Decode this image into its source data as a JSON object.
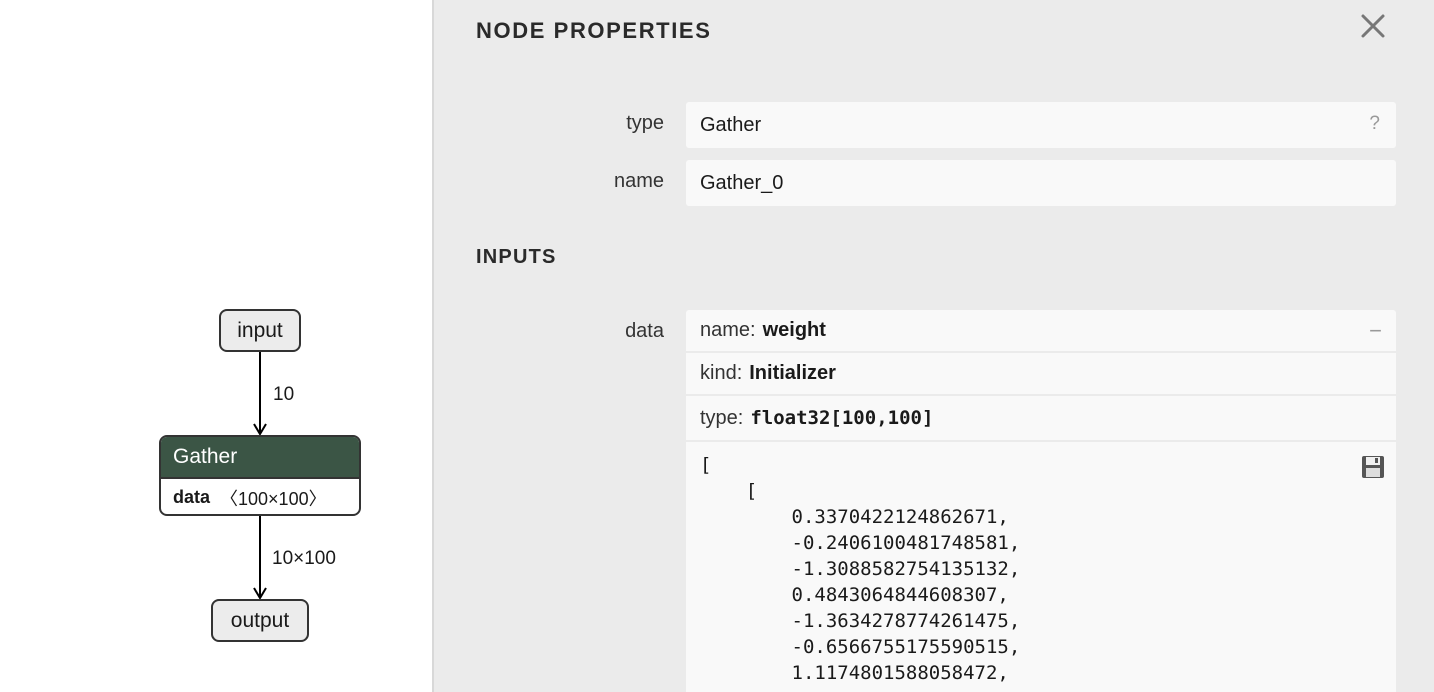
{
  "graph": {
    "input_node": "input",
    "output_node": "output",
    "gather_node": {
      "title": "Gather",
      "attr_name": "data",
      "attr_value": "〈100×100〉"
    },
    "edge_input_to_gather": "10",
    "edge_gather_to_output": "10×100"
  },
  "sidebar": {
    "title": "NODE PROPERTIES",
    "close_icon": "close-icon",
    "properties": {
      "type_label": "type",
      "type_value": "Gather",
      "type_help": "?",
      "name_label": "name",
      "name_value": "Gather_0"
    },
    "inputs_title": "INPUTS",
    "input_data": {
      "label": "data",
      "name_key": "name:",
      "name_value": "weight",
      "kind_key": "kind:",
      "kind_value": "Initializer",
      "type_key": "type:",
      "type_value": "float32[100,100]",
      "collapse": "−",
      "tensor_text": "[\n    [\n        0.3370422124862671,\n        -0.2406100481748581,\n        -1.3088582754135132,\n        0.4843064844608307,\n        -1.3634278774261475,\n        -0.6566755175590515,\n        1.1174801588058472,"
    }
  },
  "colors": {
    "gather_header": "#3b5545",
    "sidebar_bg": "#ebebeb",
    "field_bg": "#f9f9f9"
  }
}
